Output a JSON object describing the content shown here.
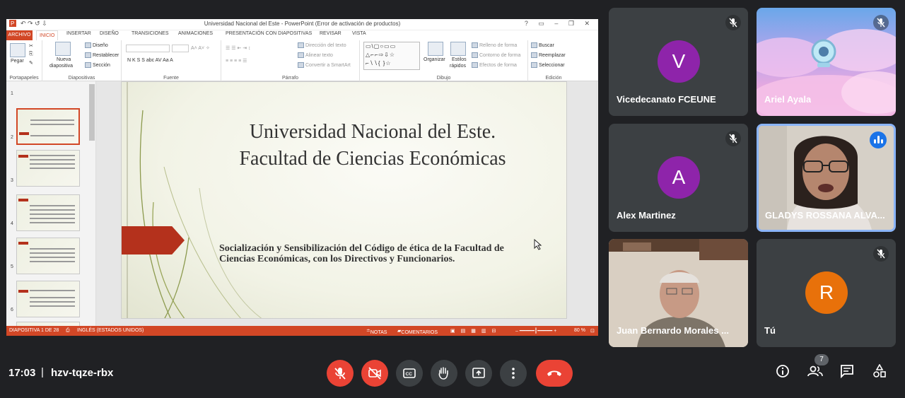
{
  "powerpoint": {
    "window_title": "Universidad Nacional del Este - PowerPoint (Error de activación de productos)",
    "window_controls": "? ▭ – ❐ ✕",
    "quick_access": "↶ ↷ ↺ ⇩",
    "tabs": [
      "ARCHIVO",
      "INICIO",
      "INSERTAR",
      "DISEÑO",
      "TRANSICIONES",
      "ANIMACIONES",
      "PRESENTACIÓN CON DIAPOSITIVAS",
      "REVISAR",
      "VISTA"
    ],
    "ribbon": {
      "paste": "Pegar",
      "new_slide_1": "Nueva",
      "new_slide_2": "diapositiva",
      "design": "Diseño",
      "reset": "Restablecer",
      "section": "Sección",
      "text_direction": "Dirección del texto",
      "align_text": "Alinear texto",
      "smartart": "Convertir a SmartArt",
      "arrange": "Organizar",
      "quick_styles_1": "Estilos",
      "quick_styles_2": "rápidos",
      "shape_fill": "Relleno de forma",
      "shape_outline": "Contorno de forma",
      "shape_effects": "Efectos de forma",
      "find": "Buscar",
      "replace": "Reemplazar",
      "select": "Seleccionar",
      "font_buttons": "N K S S abc AV Aa A",
      "shapes_gallery": "▭\\▢○▭▭\n△⌐⌐⇨⇩☆\n⌐∖∖{ }☆"
    },
    "groups": [
      "Portapapeles",
      "Diapositivas",
      "Fuente",
      "Párrafo",
      "Dibujo",
      "Edición"
    ],
    "thumbnail_numbers": [
      "1",
      "2",
      "3",
      "4",
      "5",
      "6"
    ],
    "slide": {
      "title_line1": "Universidad Nacional del Este.",
      "title_line2": "Facultad de Ciencias Económicas",
      "subtitle": "Socialización y Sensibilización del Código de ética de la Facultad de Ciencias Económicas, con los Directivos y Funcionarios."
    },
    "status": {
      "slide_of": "DIAPOSITIVA 1 DE 28",
      "language": "INGLÉS (ESTADOS UNIDOS)",
      "notes": "NOTAS",
      "comments": "COMENTARIOS",
      "zoom": "80 %"
    }
  },
  "participants": [
    {
      "name": "Vicedecanato FCEUNE",
      "initial": "V",
      "avatar_color": "#8e24aa",
      "muted": true
    },
    {
      "name": "Ariel Ayala",
      "muted": true
    },
    {
      "name": "Alex Martinez",
      "initial": "A",
      "avatar_color": "#8e24aa",
      "muted": true
    },
    {
      "name": "GLADYS ROSSANA ALVA...",
      "speaking": true
    },
    {
      "name": "Juan Bernardo Morales ..."
    },
    {
      "name": "Tú",
      "initial": "R",
      "avatar_color": "#e8710a",
      "muted": true
    }
  ],
  "meeting": {
    "time": "17:03",
    "code": "hzv-tqze-rbx",
    "participant_count": "7"
  },
  "colors": {
    "background": "#202124",
    "tile": "#3c4043",
    "danger": "#ea4335",
    "ppt_accent": "#d24726"
  }
}
